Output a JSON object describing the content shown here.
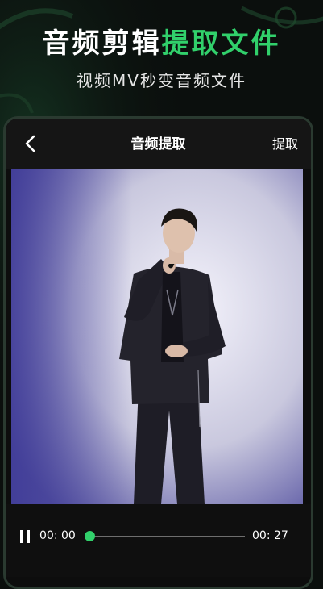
{
  "header": {
    "title_main": "音频剪辑",
    "title_accent": "提取文件",
    "subtitle": "视频MV秒变音频文件"
  },
  "nav": {
    "title": "音频提取",
    "action_label": "提取"
  },
  "player": {
    "current_time": "00: 00",
    "total_time": "00: 27",
    "progress_fraction": 0.0
  },
  "colors": {
    "accent": "#31d06b",
    "background": "#0b0f0d",
    "nav_bar": "#151515"
  },
  "icons": {
    "back": "chevron-left-icon",
    "pause": "pause-icon"
  }
}
